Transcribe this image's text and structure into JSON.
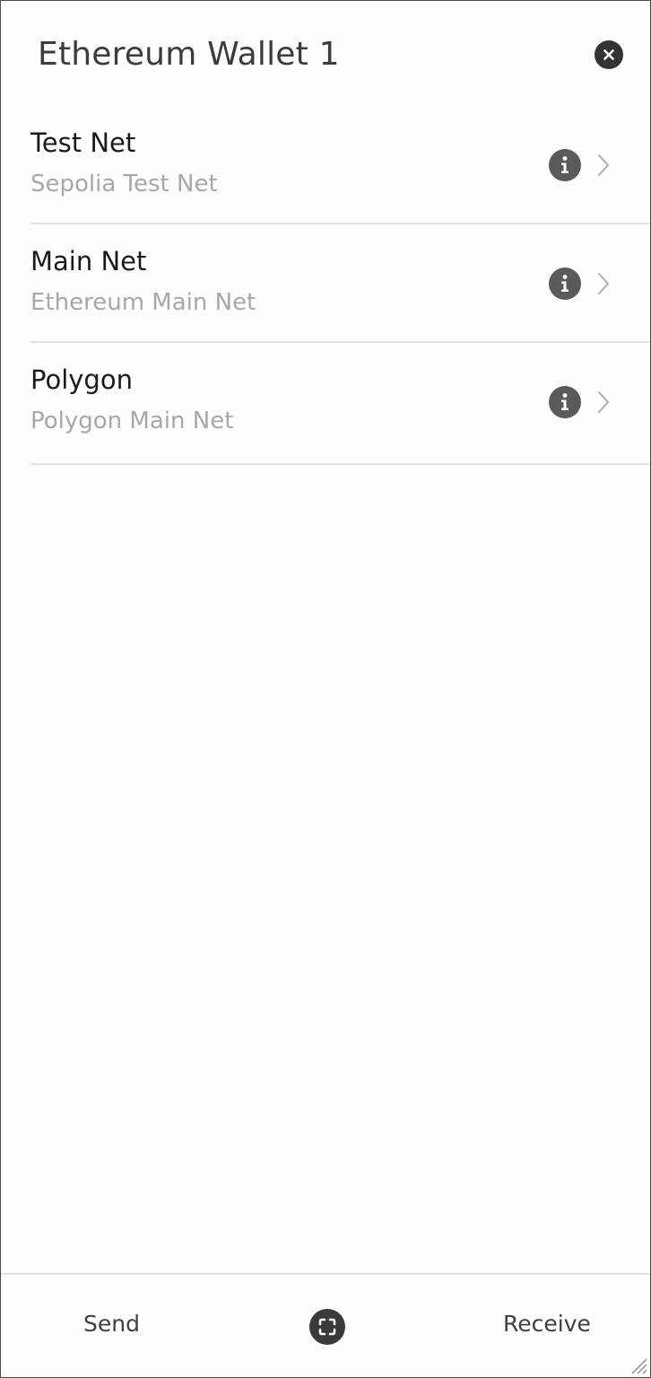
{
  "window": {
    "title": "Ethereum Wallet 1"
  },
  "header": {
    "close_icon": "close-icon"
  },
  "networks": [
    {
      "name": "Test Net",
      "subtitle": "Sepolia Test Net"
    },
    {
      "name": "Main Net",
      "subtitle": "Ethereum Main Net"
    },
    {
      "name": "Polygon",
      "subtitle": "Polygon Main Net"
    }
  ],
  "icons": {
    "info": "info-icon",
    "chevron": "chevron-right-icon",
    "scan": "scan-icon"
  },
  "footer": {
    "send_label": "Send",
    "receive_label": "Receive"
  },
  "colors": {
    "title": "#3c3c3c",
    "subtitle": "#a8a8a8",
    "icon_dark": "#5a5a5a",
    "divider": "#e2e2e2"
  }
}
